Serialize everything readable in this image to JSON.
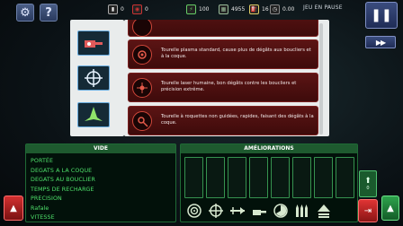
{
  "topbar": {
    "resources": [
      {
        "name": "crew",
        "value": "0",
        "icon": "crew-icon"
      },
      {
        "name": "missiles",
        "value": "0",
        "icon": "missile-icon"
      },
      {
        "name": "energy",
        "value": "100",
        "icon": "energy-icon"
      },
      {
        "name": "scrap",
        "value": "4955",
        "icon": "scrap-icon"
      },
      {
        "name": "fuel",
        "value": "16",
        "icon": "fuel-icon"
      },
      {
        "name": "time",
        "value": "0.00",
        "icon": "clock-icon"
      }
    ],
    "pause_text": "JEU EN PAUSE"
  },
  "weapons": [
    {
      "icon": "plasma-turret-icon",
      "text": "Tourelle plasma standard, cause plus de dégâts aux boucliers et à la coque."
    },
    {
      "icon": "laser-turret-icon",
      "text": "Tourelle laser humaine, bon dégâts contre les boucliers et précision extrême."
    },
    {
      "icon": "rocket-turret-icon",
      "text": "Tourelle à roquettes non guidées, rapides, faisant des dégâts à la coque."
    }
  ],
  "stats": {
    "header": "VIDE",
    "items": [
      "PORTÉE",
      "DEGATS A LA COQUE",
      "DEGATS AU BOUCLIER",
      "TEMPS DE RECHARGE",
      "PRECISION",
      "Rafale",
      "VITESSE"
    ]
  },
  "upgrades": {
    "header": "AMÉLIORATIONS",
    "side_count": "0"
  },
  "colors": {
    "accent_green": "#4ee06a",
    "card_red": "#5b1414",
    "panel_bg": "#e9ecec"
  }
}
